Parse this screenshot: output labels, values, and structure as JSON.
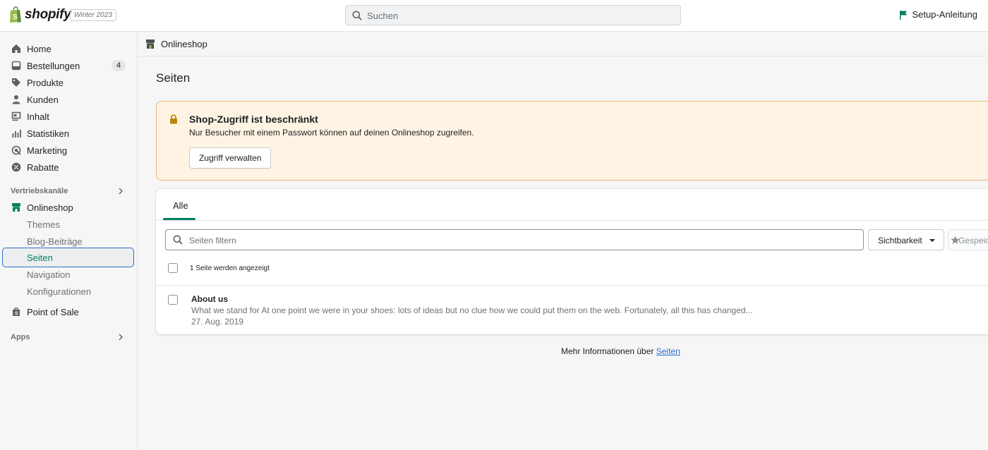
{
  "topbar": {
    "brand": "shopify",
    "edition": "Winter 2023",
    "search_placeholder": "Suchen",
    "setup_label": "Setup-Anleitung"
  },
  "sidebar": {
    "items": [
      {
        "label": "Home",
        "icon": "home-icon"
      },
      {
        "label": "Bestellungen",
        "icon": "orders-icon",
        "badge": "4"
      },
      {
        "label": "Produkte",
        "icon": "tag-icon"
      },
      {
        "label": "Kunden",
        "icon": "person-icon"
      },
      {
        "label": "Inhalt",
        "icon": "content-icon"
      },
      {
        "label": "Statistiken",
        "icon": "bar-chart-icon"
      },
      {
        "label": "Marketing",
        "icon": "target-icon"
      },
      {
        "label": "Rabatte",
        "icon": "discount-icon"
      }
    ],
    "sales_channels_label": "Vertriebskanäle",
    "onlineshop": {
      "label": "Onlineshop",
      "sub": [
        "Themes",
        "Blog-Beiträge",
        "Seiten",
        "Navigation",
        "Konfigurationen"
      ],
      "active": "Seiten"
    },
    "pos_label": "Point of Sale",
    "apps_label": "Apps"
  },
  "breadcrumb": {
    "label": "Onlineshop"
  },
  "page": {
    "title": "Seiten"
  },
  "banner": {
    "title": "Shop-Zugriff ist beschränkt",
    "message": "Nur Besucher mit einem Passwort können auf deinen Onlineshop zugreifen.",
    "button": "Zugriff verwalten"
  },
  "card": {
    "tab": "Alle",
    "filter_placeholder": "Seiten filtern",
    "visibility_label": "Sichtbarkeit",
    "saved_label": "Gespeic",
    "count_text": "1 Seite werden angezeigt",
    "rows": [
      {
        "title": "About us",
        "description": "What we stand for At one point we were in your shoes: lots of ideas but no clue how we could put them on the web. Fortunately, all this has changed...",
        "date": "27. Aug. 2019"
      }
    ]
  },
  "footer": {
    "text": "Mehr Informationen über ",
    "link": "Seiten"
  },
  "colors": {
    "accent_green": "#008060",
    "link_blue": "#2c6ecb",
    "banner_bg": "#fff4e4",
    "banner_border": "#e8b878"
  }
}
